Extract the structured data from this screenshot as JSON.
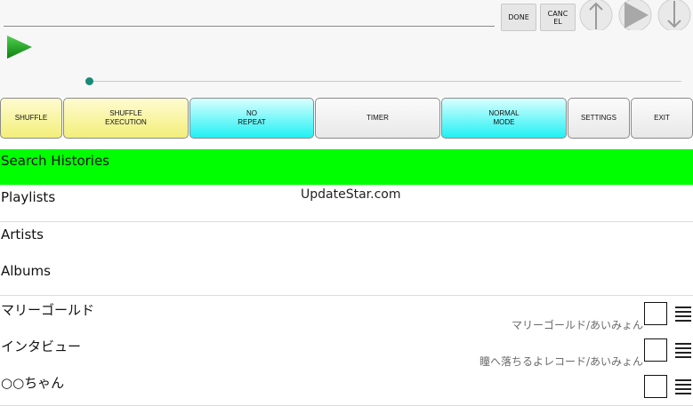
{
  "topbar": {
    "done_label": "DONE",
    "cancel_label": "CANC\nEL",
    "icons": [
      "up-arrow-icon",
      "play-icon",
      "down-arrow-icon"
    ]
  },
  "player": {
    "play_icon": "play-icon",
    "seek_progress_percent": 0
  },
  "mode_buttons": [
    {
      "label": "SHUFFLE",
      "color": "#f5f07a"
    },
    {
      "label": "SHUFFLE\nEXECUTION",
      "color": "#f5f07a"
    },
    {
      "label": "NO\nREPEAT",
      "color": "#22f0f3"
    },
    {
      "label": "TIMER",
      "color": "#eeeeee"
    },
    {
      "label": "NORMAL\nMODE",
      "color": "#22f0f3"
    },
    {
      "label": "SETTINGS",
      "color": "#eeeeee"
    },
    {
      "label": "EXIT",
      "color": "#eeeeee"
    }
  ],
  "list": {
    "search_histories": "Search Histories",
    "categories": [
      "Playlists",
      "Artists",
      "Albums"
    ],
    "songs": [
      {
        "title": "マリーゴールド",
        "subtitle": "マリーゴールド/あいみょん"
      },
      {
        "title": "インタビュー",
        "subtitle": "瞳へ落ちるよレコード/あいみょん"
      },
      {
        "title": "○○ちゃん",
        "subtitle": ""
      }
    ]
  },
  "watermark": "UpdateStar.com",
  "accent_colors": {
    "highlight": "#00ff00",
    "seek": "#1a8a78",
    "play": "#1fa31f"
  }
}
